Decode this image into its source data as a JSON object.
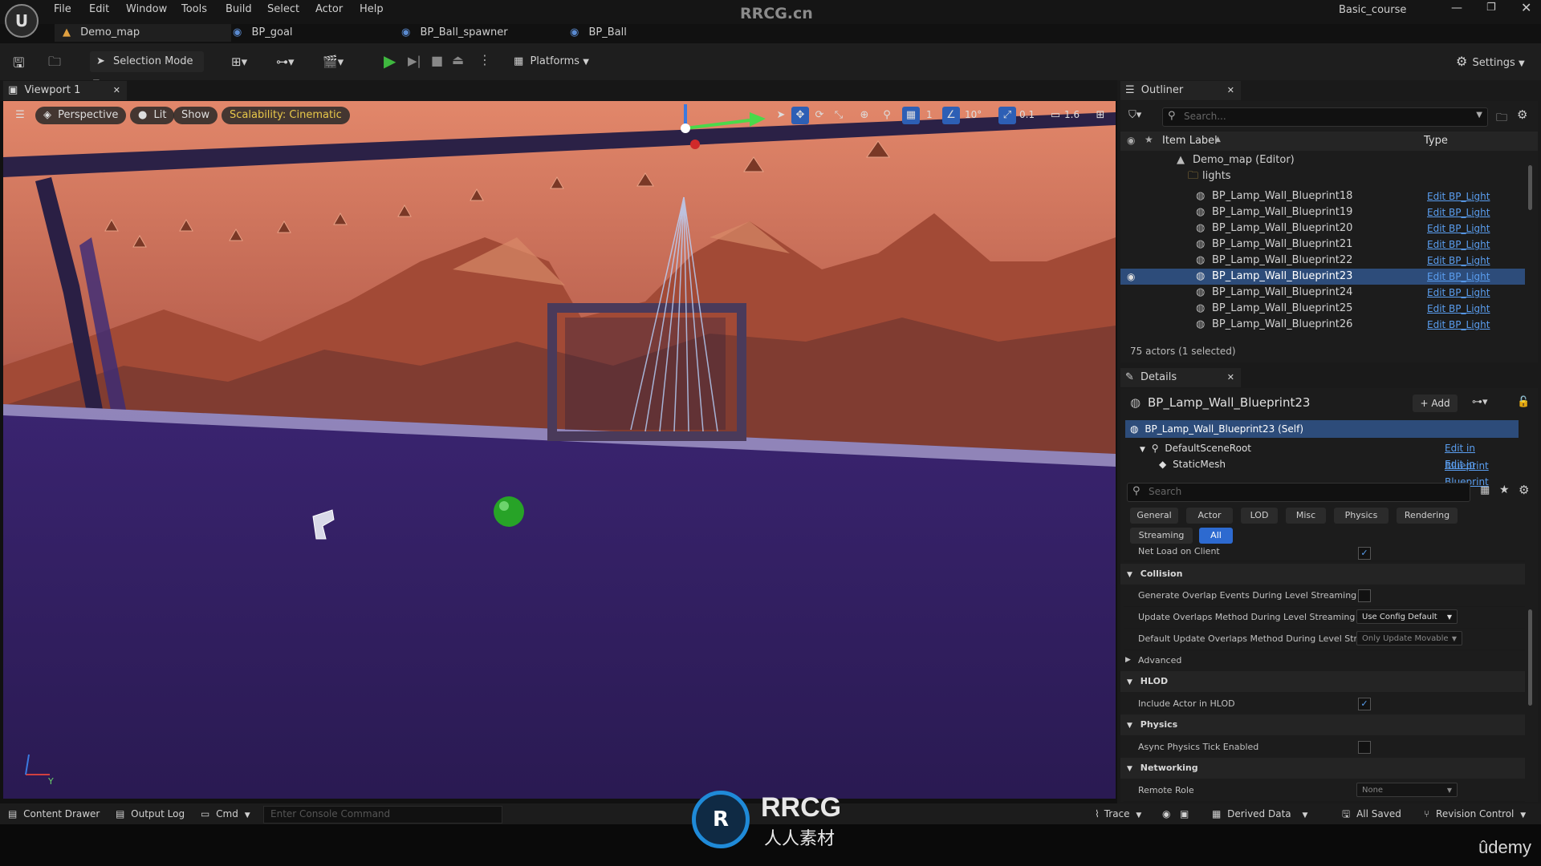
{
  "watermark": "RRCG.cn",
  "window_title": "Basic_course",
  "menu": [
    "File",
    "Edit",
    "Window",
    "Tools",
    "Build",
    "Select",
    "Actor",
    "Help"
  ],
  "doc_tabs": [
    "Demo_map",
    "BP_goal",
    "BP_Ball_spawner",
    "BP_Ball"
  ],
  "toolbar": {
    "selection_mode": "Selection Mode",
    "platforms": "Platforms",
    "settings": "Settings"
  },
  "viewport": {
    "tab": "Viewport 1",
    "perspective": "Perspective",
    "lit": "Lit",
    "show": "Show",
    "scalability": "Scalability: Cinematic",
    "grid_value": "1",
    "angle_value": "10°",
    "scale_value": "0.1",
    "camera_speed": "1.6"
  },
  "outliner": {
    "tab": "Outliner",
    "search_placeholder": "Search...",
    "col_label": "Item Label",
    "col_type": "Type",
    "root": "Demo_map (Editor)",
    "folder": "lights",
    "rows": [
      {
        "label": "BP_Lamp_Wall_Blueprint18",
        "type": "Edit BP_Light"
      },
      {
        "label": "BP_Lamp_Wall_Blueprint19",
        "type": "Edit BP_Light"
      },
      {
        "label": "BP_Lamp_Wall_Blueprint20",
        "type": "Edit BP_Light"
      },
      {
        "label": "BP_Lamp_Wall_Blueprint21",
        "type": "Edit BP_Light"
      },
      {
        "label": "BP_Lamp_Wall_Blueprint22",
        "type": "Edit BP_Light"
      },
      {
        "label": "BP_Lamp_Wall_Blueprint23",
        "type": "Edit BP_Light"
      },
      {
        "label": "BP_Lamp_Wall_Blueprint24",
        "type": "Edit BP_Light"
      },
      {
        "label": "BP_Lamp_Wall_Blueprint25",
        "type": "Edit BP_Light"
      },
      {
        "label": "BP_Lamp_Wall_Blueprint26",
        "type": "Edit BP_Light"
      }
    ],
    "actor_count": "75 actors (1 selected)"
  },
  "details": {
    "tab": "Details",
    "actor_name": "BP_Lamp_Wall_Blueprint23",
    "add_label": "Add",
    "self_row": "BP_Lamp_Wall_Blueprint23 (Self)",
    "components": [
      {
        "name": "DefaultSceneRoot",
        "link": "Edit in Blueprint"
      },
      {
        "name": "StaticMesh",
        "link": "Edit in Blueprint"
      }
    ],
    "search_placeholder": "Search",
    "categories": [
      "General",
      "Actor",
      "LOD",
      "Misc",
      "Physics",
      "Rendering",
      "Streaming",
      "All"
    ],
    "net_load": "Net Load on Client",
    "sections": {
      "collision": "Collision",
      "advanced": "Advanced",
      "hlod": "HLOD",
      "physics": "Physics",
      "networking": "Networking"
    },
    "props": {
      "gen_overlap": "Generate Overlap Events During Level Streaming",
      "update_overlap": "Update Overlaps Method During Level Streaming",
      "update_overlap_value": "Use Config Default",
      "default_update": "Default Update Overlaps Method During Level Str...",
      "default_update_value": "Only Update Movable",
      "include_hlod": "Include Actor in HLOD",
      "async_physics": "Async Physics Tick Enabled",
      "remote_role": "Remote Role",
      "remote_role_value": "None"
    }
  },
  "status": {
    "content_drawer": "Content Drawer",
    "output_log": "Output Log",
    "cmd": "Cmd",
    "console_placeholder": "Enter Console Command",
    "trace": "Trace",
    "derived_data": "Derived Data",
    "all_saved": "All Saved",
    "revision_control": "Revision Control"
  },
  "logo_text": "RRCG",
  "logo_sub": "人人素材",
  "udemy": "ûdemy"
}
